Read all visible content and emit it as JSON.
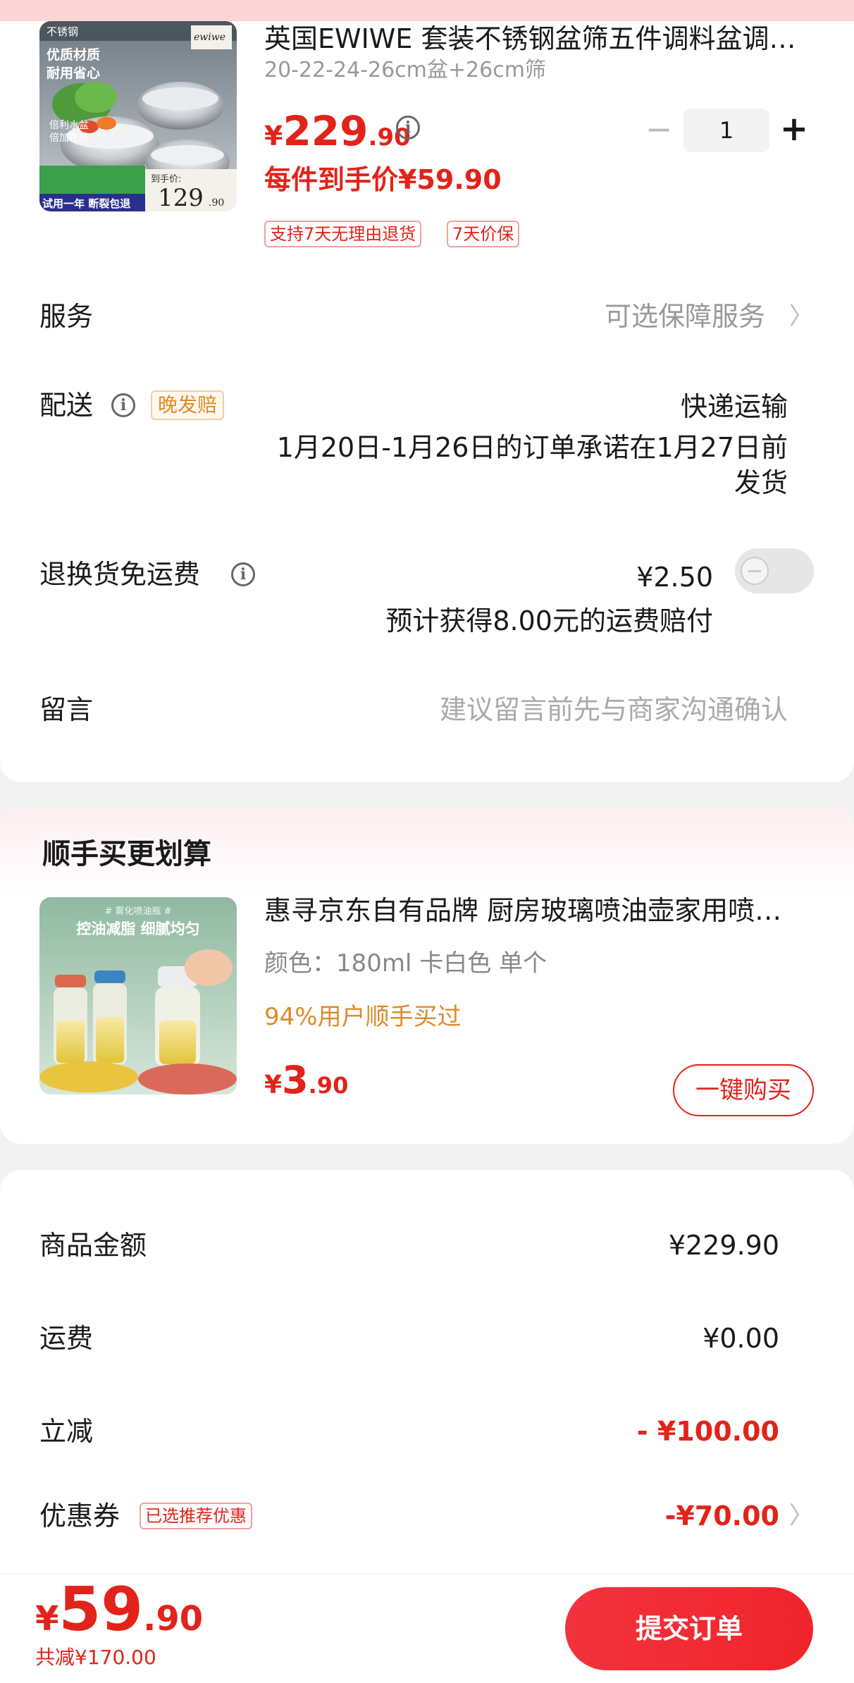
{
  "product": {
    "title": "英国EWIWE 套装不锈钢盆筛五件调料盆调料...",
    "spec": "20-22-24-26cm盆+26cm筛",
    "price_currency": "¥",
    "price_integer": "229",
    "price_decimal": ".90",
    "per_item_price": "每件到手价¥59.90",
    "tags": [
      "支持7天无理由退货",
      "7天价保"
    ],
    "quantity": "1",
    "image_texts": {
      "badge": "不锈钢",
      "brand": "ewiwe",
      "line1": "优质材质",
      "line2": "耐用省心",
      "feature1": "倍利水盆",
      "feature2": "倍加在线",
      "bottom": "试用一年  断裂包退",
      "deal": "到手价:",
      "deal_price": "129",
      "deal_decimal": ".90"
    }
  },
  "service": {
    "label": "服务",
    "value": "可选保障服务"
  },
  "delivery": {
    "label": "配送",
    "badge": "晚发赔",
    "method": "快递运输",
    "promise_line1": "1月20日-1月26日的订单承诺在1月27日前",
    "promise_line2": "发货"
  },
  "return_shipping": {
    "label": "退换货免运费",
    "price": "¥2.50",
    "note": "预计获得8.00元的运费赔付",
    "enabled": false
  },
  "message": {
    "label": "留言",
    "placeholder": "建议留言前先与商家沟通确认"
  },
  "addon": {
    "section_title": "顺手买更划算",
    "title": "惠寻京东自有品牌 厨房玻璃喷油壶家用喷油瓶",
    "spec": "颜色：180ml 卡白色 单个",
    "bought": "94%用户顺手买过",
    "price_currency": "¥",
    "price_integer": "3",
    "price_decimal": ".90",
    "buy_button": "一键购买",
    "image_texts": {
      "top": "# 雾化喷油瓶 #",
      "slogan": "控油减脂  细腻均匀"
    }
  },
  "summary": {
    "goods_label": "商品金额",
    "goods_value": "¥229.90",
    "freight_label": "运费",
    "freight_value": "¥0.00",
    "discount_label": "立减",
    "discount_value": "- ¥100.00",
    "coupon_label": "优惠券",
    "coupon_tag": "已选推荐优惠",
    "coupon_value": "-¥70.00"
  },
  "footer": {
    "total_currency": "¥",
    "total_integer": "59",
    "total_decimal": ".90",
    "saved": "共减¥170.00",
    "submit": "提交订单"
  },
  "colors": {
    "accent_red": "#e2231a",
    "gold": "#e08a26",
    "page_bg": "#f2f2f2"
  }
}
